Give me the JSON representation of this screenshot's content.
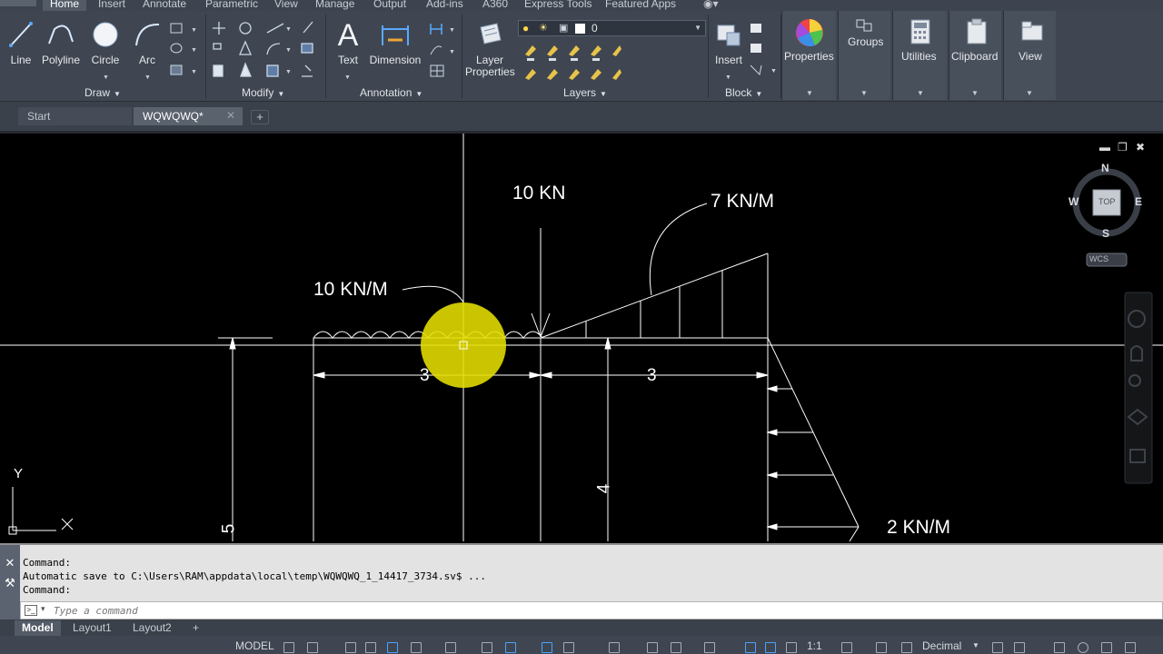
{
  "ribbon": {
    "tabs": [
      "Home",
      "Insert",
      "Annotate",
      "Parametric",
      "View",
      "Manage",
      "Output",
      "Add-ins",
      "A360",
      "Express Tools",
      "Featured Apps"
    ],
    "active_tab": "Home",
    "draw": {
      "line": "Line",
      "polyline": "Polyline",
      "circle": "Circle",
      "arc": "Arc",
      "title": "Draw"
    },
    "modify": {
      "title": "Modify"
    },
    "annotation": {
      "text": "Text",
      "dimension": "Dimension",
      "title": "Annotation"
    },
    "layers": {
      "layer_properties_line1": "Layer",
      "layer_properties_line2": "Properties",
      "current_layer": "0",
      "title": "Layers"
    },
    "block": {
      "insert": "Insert",
      "title": "Block"
    },
    "properties": "Properties",
    "groups": "Groups",
    "utilities": "Utilities",
    "clipboard": "Clipboard",
    "view": "View"
  },
  "doc_tabs": {
    "start": "Start",
    "file": "WQWQWQ*"
  },
  "viewcube": {
    "n": "N",
    "s": "S",
    "e": "E",
    "w": "W",
    "top": "TOP",
    "wcs": "WCS"
  },
  "ucs": {
    "y": "Y"
  },
  "drawing": {
    "load_10kn": "10 KN",
    "load_7knm": "7 KN/M",
    "load_10knm": "10 KN/M",
    "load_2knm": "2 KN/M",
    "dim_3_left": "3",
    "dim_3_right": "3",
    "dim_4": "4",
    "dim_5": "5"
  },
  "command": {
    "line1": "Command:",
    "line2": "Automatic save to C:\\Users\\RAM\\appdata\\local\\temp\\WQWQWQ_1_14417_3734.sv$ ...",
    "line3": "Command:",
    "placeholder": "Type a command"
  },
  "layout_tabs": [
    "Model",
    "Layout1",
    "Layout2"
  ],
  "status": {
    "model": "MODEL",
    "scale": "1:1",
    "units": "Decimal"
  },
  "colors": {
    "ribbon_bg": "#3f4651",
    "canvas_bg": "#000000",
    "highlight": "#e6e000",
    "accent": "#4aa3ff"
  }
}
